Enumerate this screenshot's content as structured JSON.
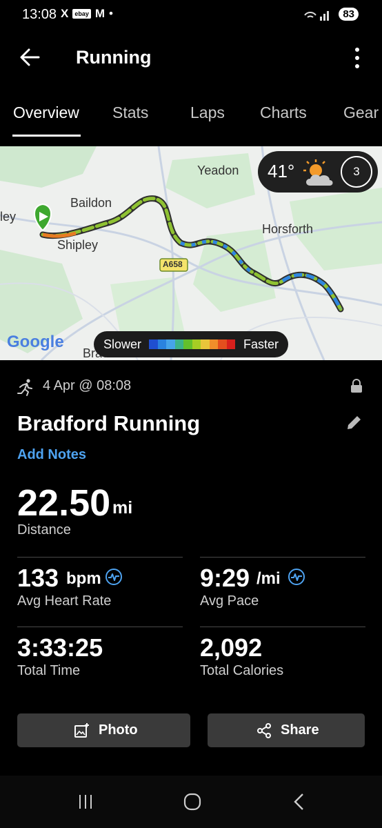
{
  "status_bar": {
    "time": "13:08",
    "app_icons": [
      "X",
      "ebay",
      "M",
      "•"
    ],
    "battery": "83"
  },
  "header": {
    "title": "Running"
  },
  "tabs": [
    {
      "label": "Overview",
      "active": true
    },
    {
      "label": "Stats",
      "active": false
    },
    {
      "label": "Laps",
      "active": false
    },
    {
      "label": "Charts",
      "active": false
    },
    {
      "label": "Gear",
      "active": false
    }
  ],
  "map": {
    "places": [
      "Yeadon",
      "Baildon",
      "Shipley",
      "Horsforth",
      "ley",
      "Bradford"
    ],
    "road_label": "A658",
    "attribution": "Google",
    "weather": {
      "temperature": "41°",
      "icon": "partly-cloudy-icon"
    },
    "lap_count": "3",
    "legend": {
      "slower": "Slower",
      "faster": "Faster",
      "colors": [
        "#1f4fd0",
        "#2a83e0",
        "#46a4ea",
        "#3cb38a",
        "#63c02c",
        "#a6cd24",
        "#e9c53a",
        "#f08e2a",
        "#e44f1e",
        "#d8201c"
      ]
    }
  },
  "activity": {
    "date": "4 Apr @ 08:08",
    "name": "Bradford Running",
    "add_notes": "Add Notes",
    "distance": {
      "value": "22.50",
      "unit": "mi",
      "label": "Distance"
    },
    "heart_rate": {
      "value": "133",
      "unit": "bpm",
      "label": "Avg Heart Rate"
    },
    "pace": {
      "value": "9:29",
      "unit": "/mi",
      "label": "Avg Pace"
    },
    "total_time": {
      "value": "3:33:25",
      "label": "Total Time"
    },
    "calories": {
      "value": "2,092",
      "label": "Total Calories"
    }
  },
  "actions": {
    "photo": "Photo",
    "share": "Share"
  }
}
